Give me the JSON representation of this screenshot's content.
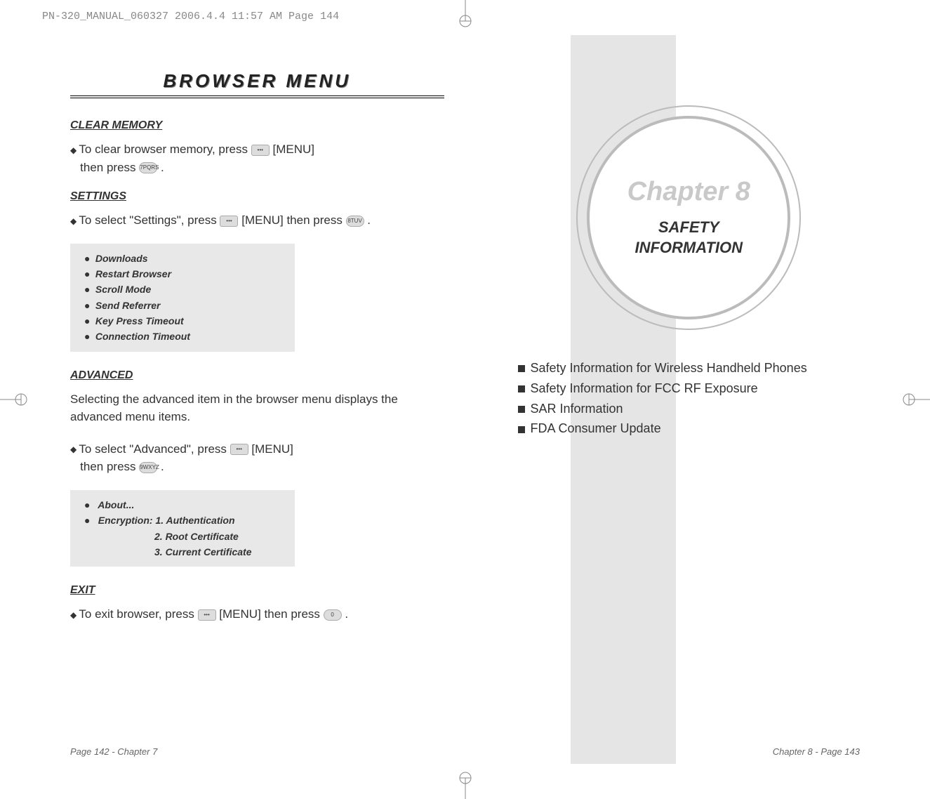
{
  "header_text": "PN-320_MANUAL_060327  2006.4.4  11:57 AM  Page 144",
  "left_page": {
    "title": "BROWSER MENU",
    "sections": {
      "clear_memory": {
        "heading": "CLEAR MEMORY",
        "instruction_prefix": "To clear browser memory, press",
        "instruction_mid": "[MENU]",
        "instruction_line2": "then press",
        "instruction_suffix": "."
      },
      "settings": {
        "heading": "SETTINGS",
        "instruction_prefix": "To select \"Settings\", press",
        "instruction_mid": "[MENU] then press",
        "instruction_suffix": ".",
        "items": [
          "Downloads",
          "Restart Browser",
          "Scroll Mode",
          "Send Referrer",
          "Key Press Timeout",
          "Connection Timeout"
        ]
      },
      "advanced": {
        "heading": "ADVANCED",
        "paragraph": "Selecting the advanced item in the browser menu displays the advanced menu items.",
        "instruction_prefix": "To select \"Advanced\", press",
        "instruction_mid": "[MENU]",
        "instruction_line2": "then press",
        "instruction_suffix": ".",
        "items": {
          "about": "About...",
          "encryption_label": "Encryption: 1. Authentication",
          "encryption_2": "2. Root Certificate",
          "encryption_3": "3. Current Certificate"
        }
      },
      "exit": {
        "heading": "EXIT",
        "instruction_prefix": "To exit browser, press",
        "instruction_mid": "[MENU] then press",
        "instruction_suffix": "."
      }
    },
    "footer": "Page 142 - Chapter 7"
  },
  "right_page": {
    "chapter_title": "Chapter 8",
    "chapter_subtitle_1": "SAFETY",
    "chapter_subtitle_2": "INFORMATION",
    "toc": [
      "Safety Information for Wireless Handheld Phones",
      "Safety Information for FCC RF Exposure",
      "SAR Information",
      "FDA Consumer Update"
    ],
    "footer": "Chapter 8 - Page 143"
  },
  "buttons": {
    "menu": "•••",
    "seven": "7PQRS",
    "eight": "8TUV",
    "nine": "9WXYZ",
    "zero": "0"
  }
}
